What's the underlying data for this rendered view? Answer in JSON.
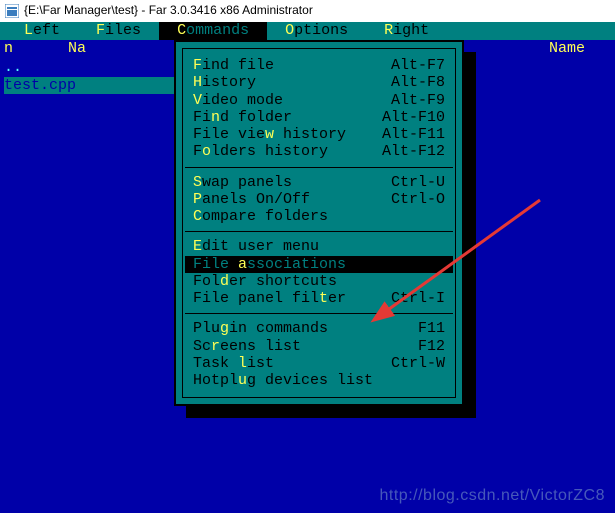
{
  "window": {
    "title": "{E:\\Far Manager\\test} - Far 3.0.3416 x86 Administrator"
  },
  "menus": {
    "items": [
      {
        "pre": "",
        "hl": "L",
        "post": "eft"
      },
      {
        "pre": "",
        "hl": "F",
        "post": "iles"
      },
      {
        "pre": "",
        "hl": "C",
        "post": "ommands"
      },
      {
        "pre": "",
        "hl": "O",
        "post": "ptions"
      },
      {
        "pre": "",
        "hl": "R",
        "post": "ight"
      }
    ],
    "active_index": 2
  },
  "left_panel": {
    "head": {
      "col1": "n",
      "col2": "Na"
    },
    "rows": [
      {
        "text": "..",
        "selected": false
      },
      {
        "text": "test.cpp",
        "selected": true
      }
    ]
  },
  "right_panel": {
    "head": "Name"
  },
  "dropdown": {
    "groups": [
      [
        {
          "pre": "",
          "hl": "F",
          "post": "ind file",
          "hotkey": "Alt-F7"
        },
        {
          "pre": "",
          "hl": "H",
          "post": "istory",
          "hotkey": "Alt-F8"
        },
        {
          "pre": "",
          "hl": "V",
          "post": "ideo mode",
          "hotkey": "Alt-F9"
        },
        {
          "pre": "Fi",
          "hl": "n",
          "post": "d folder",
          "hotkey": "Alt-F10"
        },
        {
          "pre": "File vie",
          "hl": "w",
          "post": " history",
          "hotkey": "Alt-F11"
        },
        {
          "pre": "F",
          "hl": "o",
          "post": "lders history",
          "hotkey": "Alt-F12"
        }
      ],
      [
        {
          "pre": "",
          "hl": "S",
          "post": "wap panels",
          "hotkey": "Ctrl-U"
        },
        {
          "pre": "",
          "hl": "P",
          "post": "anels On/Off",
          "hotkey": "Ctrl-O"
        },
        {
          "pre": "",
          "hl": "C",
          "post": "ompare folders",
          "hotkey": ""
        }
      ],
      [
        {
          "pre": "",
          "hl": "E",
          "post": "dit user menu",
          "hotkey": ""
        },
        {
          "pre": "File ",
          "hl": "a",
          "post": "ssociations",
          "hotkey": "",
          "selected": true
        },
        {
          "pre": "Fol",
          "hl": "d",
          "post": "er shortcuts",
          "hotkey": ""
        },
        {
          "pre": "File panel fil",
          "hl": "t",
          "post": "er",
          "hotkey": "Ctrl-I"
        }
      ],
      [
        {
          "pre": "Plu",
          "hl": "g",
          "post": "in commands",
          "hotkey": "F11"
        },
        {
          "pre": "Sc",
          "hl": "r",
          "post": "eens list",
          "hotkey": "F12"
        },
        {
          "pre": "Task ",
          "hl": "l",
          "post": "ist",
          "hotkey": "Ctrl-W"
        },
        {
          "pre": "Hotpl",
          "hl": "u",
          "post": "g devices list",
          "hotkey": ""
        }
      ]
    ]
  },
  "watermark": "http://blog.csdn.net/VictorZC8"
}
